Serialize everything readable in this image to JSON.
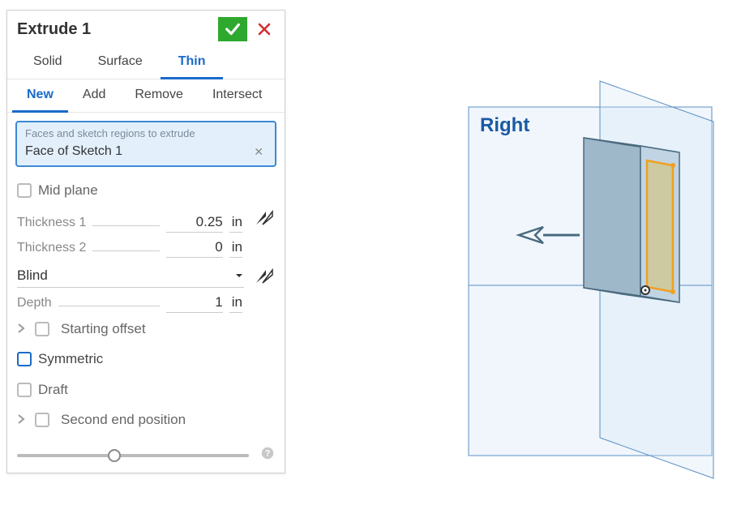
{
  "panel": {
    "title": "Extrude 1",
    "tabs_group1": [
      "Solid",
      "Surface",
      "Thin"
    ],
    "tabs_group1_active": "Thin",
    "tabs_group2": [
      "New",
      "Add",
      "Remove",
      "Intersect"
    ],
    "tabs_group2_active": "New",
    "selection": {
      "hint": "Faces and sketch regions to extrude",
      "value": "Face of Sketch 1"
    },
    "midplane_label": "Mid plane",
    "thickness1": {
      "label": "Thickness 1",
      "value": "0.25",
      "unit": "in"
    },
    "thickness2": {
      "label": "Thickness 2",
      "value": "0",
      "unit": "in"
    },
    "end_type": {
      "value": "Blind"
    },
    "depth": {
      "label": "Depth",
      "value": "1",
      "unit": "in"
    },
    "starting_offset_label": "Starting offset",
    "symmetric_label": "Symmetric",
    "draft_label": "Draft",
    "second_end_label": "Second end position"
  },
  "viewport": {
    "plane_label": "Right"
  }
}
